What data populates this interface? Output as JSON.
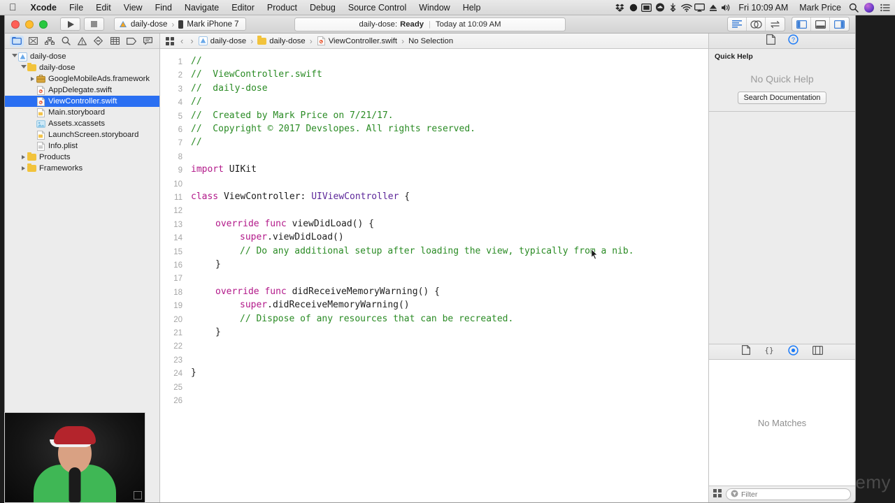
{
  "menubar": {
    "apple_icon": "apple-logo-icon",
    "items": [
      {
        "label": "Xcode",
        "bold": true
      },
      {
        "label": "File",
        "bold": false
      },
      {
        "label": "Edit",
        "bold": false
      },
      {
        "label": "View",
        "bold": false
      },
      {
        "label": "Find",
        "bold": false
      },
      {
        "label": "Navigate",
        "bold": false
      },
      {
        "label": "Editor",
        "bold": false
      },
      {
        "label": "Product",
        "bold": false
      },
      {
        "label": "Debug",
        "bold": false
      },
      {
        "label": "Source Control",
        "bold": false
      },
      {
        "label": "Window",
        "bold": false
      },
      {
        "label": "Help",
        "bold": false
      }
    ],
    "status_icons": [
      "dropbox-icon",
      "circle-icon",
      "display-icon",
      "cloud-icon",
      "bluetooth-icon",
      "wifi-icon",
      "airplay-icon",
      "eject-icon",
      "volume-icon"
    ],
    "clock": "Fri 10:09 AM",
    "user": "Mark Price",
    "search_icon": "search-icon",
    "siri_icon": "siri-icon",
    "notification_center_icon": "notification-center-icon"
  },
  "toolbar": {
    "run_button": "run-button",
    "stop_button": "stop-button",
    "scheme_target": "daily-dose",
    "scheme_destination": "Mark iPhone 7",
    "status_project": "daily-dose:",
    "status_state": "Ready",
    "status_time": "Today at 10:09 AM",
    "editor_modes": [
      "standard-editor",
      "assistant-editor",
      "version-editor"
    ],
    "view_toggles": [
      "navigator-toggle",
      "debug-area-toggle",
      "utilities-toggle"
    ]
  },
  "navigator": {
    "tabs": [
      "project-navigator",
      "source-control-navigator",
      "symbol-navigator",
      "find-navigator",
      "issue-navigator",
      "test-navigator",
      "debug-navigator",
      "breakpoint-navigator",
      "report-navigator"
    ],
    "active_tab_index": 0,
    "tree": [
      {
        "label": "daily-dose",
        "depth": 0,
        "icon": "xcode-project-icon",
        "twisty": "open",
        "selected": false
      },
      {
        "label": "daily-dose",
        "depth": 1,
        "icon": "folder-icon",
        "twisty": "open",
        "selected": false
      },
      {
        "label": "GoogleMobileAds.framework",
        "depth": 2,
        "icon": "framework-icon",
        "twisty": "closed",
        "selected": false
      },
      {
        "label": "AppDelegate.swift",
        "depth": 2,
        "icon": "swift-file-icon",
        "twisty": "none",
        "selected": false
      },
      {
        "label": "ViewController.swift",
        "depth": 2,
        "icon": "swift-file-icon",
        "twisty": "none",
        "selected": true
      },
      {
        "label": "Main.storyboard",
        "depth": 2,
        "icon": "storyboard-icon",
        "twisty": "none",
        "selected": false
      },
      {
        "label": "Assets.xcassets",
        "depth": 2,
        "icon": "assets-icon",
        "twisty": "none",
        "selected": false
      },
      {
        "label": "LaunchScreen.storyboard",
        "depth": 2,
        "icon": "storyboard-icon",
        "twisty": "none",
        "selected": false
      },
      {
        "label": "Info.plist",
        "depth": 2,
        "icon": "plist-icon",
        "twisty": "none",
        "selected": false
      },
      {
        "label": "Products",
        "depth": 1,
        "icon": "folder-icon",
        "twisty": "closed",
        "selected": false
      },
      {
        "label": "Frameworks",
        "depth": 1,
        "icon": "folder-icon",
        "twisty": "closed",
        "selected": false
      }
    ]
  },
  "jumpbar": {
    "related_items_icon": "related-items-icon",
    "back_icon": "back-chevron-icon",
    "forward_icon": "forward-chevron-icon",
    "crumbs": [
      {
        "label": "daily-dose",
        "icon": "xcode-project-icon"
      },
      {
        "label": "daily-dose",
        "icon": "folder-icon"
      },
      {
        "label": "ViewController.swift",
        "icon": "swift-file-icon"
      },
      {
        "label": "No Selection",
        "icon": "none"
      }
    ]
  },
  "editor": {
    "file_name": "ViewController.swift",
    "lines": [
      {
        "n": 1,
        "indent": 0,
        "tokens": [
          {
            "t": "//",
            "s": "c"
          }
        ]
      },
      {
        "n": 2,
        "indent": 0,
        "tokens": [
          {
            "t": "//  ViewController.swift",
            "s": "c"
          }
        ]
      },
      {
        "n": 3,
        "indent": 0,
        "tokens": [
          {
            "t": "//  daily-dose",
            "s": "c"
          }
        ]
      },
      {
        "n": 4,
        "indent": 0,
        "tokens": [
          {
            "t": "//",
            "s": "c"
          }
        ]
      },
      {
        "n": 5,
        "indent": 0,
        "tokens": [
          {
            "t": "//  Created by Mark Price on 7/21/17.",
            "s": "c"
          }
        ]
      },
      {
        "n": 6,
        "indent": 0,
        "tokens": [
          {
            "t": "//  Copyright © 2017 Devslopes. All rights reserved.",
            "s": "c"
          }
        ]
      },
      {
        "n": 7,
        "indent": 0,
        "tokens": [
          {
            "t": "//",
            "s": "c"
          }
        ]
      },
      {
        "n": 8,
        "indent": 0,
        "tokens": []
      },
      {
        "n": 9,
        "indent": 0,
        "tokens": [
          {
            "t": "import",
            "s": "k"
          },
          {
            "t": " UIKit",
            "s": "p"
          }
        ]
      },
      {
        "n": 10,
        "indent": 0,
        "tokens": []
      },
      {
        "n": 11,
        "indent": 0,
        "tokens": [
          {
            "t": "class",
            "s": "k"
          },
          {
            "t": " ViewController: ",
            "s": "p"
          },
          {
            "t": "UIViewController",
            "s": "t"
          },
          {
            "t": " {",
            "s": "p"
          }
        ]
      },
      {
        "n": 12,
        "indent": 0,
        "tokens": []
      },
      {
        "n": 13,
        "indent": 1,
        "tokens": [
          {
            "t": "override func",
            "s": "k"
          },
          {
            "t": " viewDidLoad() {",
            "s": "p"
          }
        ]
      },
      {
        "n": 14,
        "indent": 2,
        "tokens": [
          {
            "t": "super",
            "s": "k"
          },
          {
            "t": ".viewDidLoad()",
            "s": "p"
          }
        ]
      },
      {
        "n": 15,
        "indent": 2,
        "tokens": [
          {
            "t": "// Do any additional setup after loading the view, typically from a nib.",
            "s": "c"
          }
        ]
      },
      {
        "n": 16,
        "indent": 1,
        "tokens": [
          {
            "t": "}",
            "s": "p"
          }
        ]
      },
      {
        "n": 17,
        "indent": 0,
        "tokens": []
      },
      {
        "n": 18,
        "indent": 1,
        "tokens": [
          {
            "t": "override func",
            "s": "k"
          },
          {
            "t": " didReceiveMemoryWarning() {",
            "s": "p"
          }
        ]
      },
      {
        "n": 19,
        "indent": 2,
        "tokens": [
          {
            "t": "super",
            "s": "k"
          },
          {
            "t": ".didReceiveMemoryWarning()",
            "s": "p"
          }
        ]
      },
      {
        "n": 20,
        "indent": 2,
        "tokens": [
          {
            "t": "// Dispose of any resources that can be recreated.",
            "s": "c"
          }
        ]
      },
      {
        "n": 21,
        "indent": 1,
        "tokens": [
          {
            "t": "}",
            "s": "p"
          }
        ]
      },
      {
        "n": 22,
        "indent": 0,
        "tokens": []
      },
      {
        "n": 23,
        "indent": 0,
        "tokens": []
      },
      {
        "n": 24,
        "indent": 0,
        "tokens": [
          {
            "t": "}",
            "s": "p"
          }
        ]
      },
      {
        "n": 25,
        "indent": 0,
        "tokens": []
      },
      {
        "n": 26,
        "indent": 0,
        "tokens": []
      }
    ],
    "mouse_cursor": "arrow-cursor"
  },
  "utilities": {
    "tabs": [
      "file-inspector",
      "quick-help-inspector"
    ],
    "active_tab_index": 1,
    "quick_help_title": "Quick Help",
    "quick_help_empty": "No Quick Help",
    "search_documentation_label": "Search Documentation"
  },
  "library": {
    "tabs": [
      "file-template-library",
      "code-snippet-library",
      "object-library",
      "media-library"
    ],
    "active_tab_index": 2,
    "empty_label": "No Matches",
    "grid_view_icon": "grid-view-icon",
    "filter_placeholder": "Filter",
    "filter_value": ""
  },
  "overlay": {
    "webcam_label": "webcam-video",
    "watermark": "emy"
  },
  "colors": {
    "selection_blue": "#2a6ff2",
    "comment_green": "#2a8b24",
    "keyword_magenta": "#b21889",
    "type_purple": "#5c2699",
    "accent_blue": "#007aff"
  }
}
